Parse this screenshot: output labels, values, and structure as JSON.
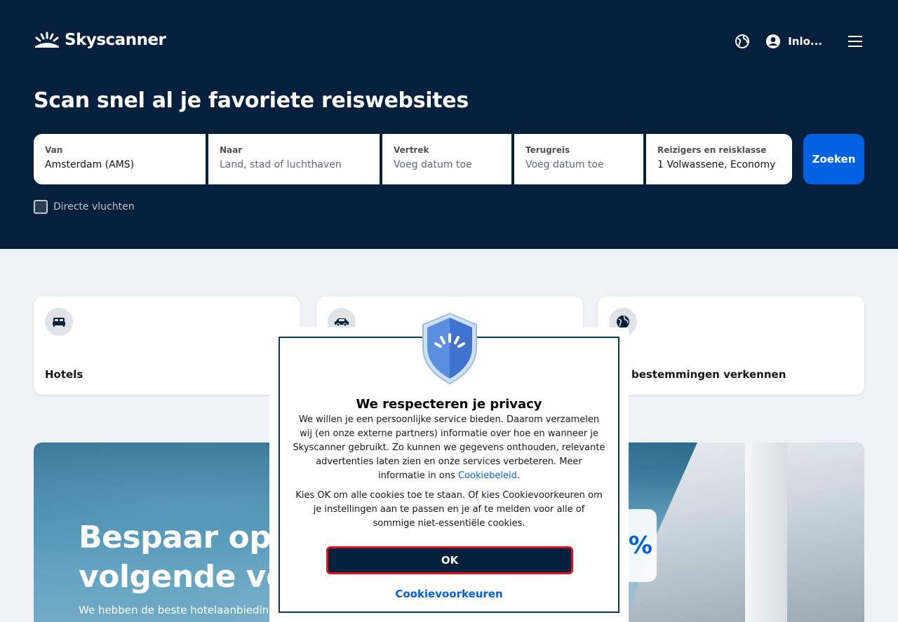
{
  "header": {
    "brand": "Skyscanner",
    "login_label": "Inlo...",
    "icons": [
      "globe-icon",
      "user-icon",
      "menu-icon"
    ]
  },
  "hero": {
    "title": "Scan snel al je favoriete reiswebsites",
    "fields": [
      {
        "label": "Van",
        "value": "Amsterdam (AMS)",
        "placeholder": ""
      },
      {
        "label": "Naar",
        "value": "",
        "placeholder": "Land, stad of luchthaven"
      },
      {
        "label": "Vertrek",
        "value": "",
        "placeholder": "Voeg datum toe"
      },
      {
        "label": "Terugreis",
        "value": "",
        "placeholder": "Voeg datum toe"
      },
      {
        "label": "Reizigers en reisklasse",
        "value": "1 Volwassene, Economy",
        "placeholder": ""
      }
    ],
    "search_button": "Zoeken",
    "direct_flights_label": "Directe vluchten",
    "direct_flights_checked": false
  },
  "cards": [
    {
      "label": "Hotels",
      "icon": "bed-icon"
    },
    {
      "label": "",
      "icon": "car-icon"
    },
    {
      "label": "bestemmingen verkennen",
      "icon": "globe-icon"
    }
  ],
  "promo": {
    "title_line1": "Bespaar op je",
    "title_line2": "volgende ver",
    "subtitle": "We hebben de beste hotelaanbiedinge",
    "badge_text": "%"
  },
  "dialog": {
    "title": "We respecteren je privacy",
    "text1": "We willen je een persoonlijke service bieden. Daarom verzamelen wij (en onze externe partners) informatie over hoe en wanneer je Skyscanner gebruikt. Zo kunnen we gegevens onthouden, relevante advertenties laten zien en onze services verbeteren. Meer informatie in ons ",
    "link_label": "Cookiebeleid",
    "link_suffix": ".",
    "text2": "Kies OK om alle cookies toe te staan. Of kies Cookievoorkeuren om je instellingen aan te passen en je af te melden voor alle of sommige niet-essentiële cookies.",
    "ok_button": "OK",
    "preferences_link": "Cookievoorkeuren"
  },
  "colors": {
    "hero_bg": "#05203c",
    "accent": "#0062e3",
    "highlight_border": "#e0101c"
  }
}
